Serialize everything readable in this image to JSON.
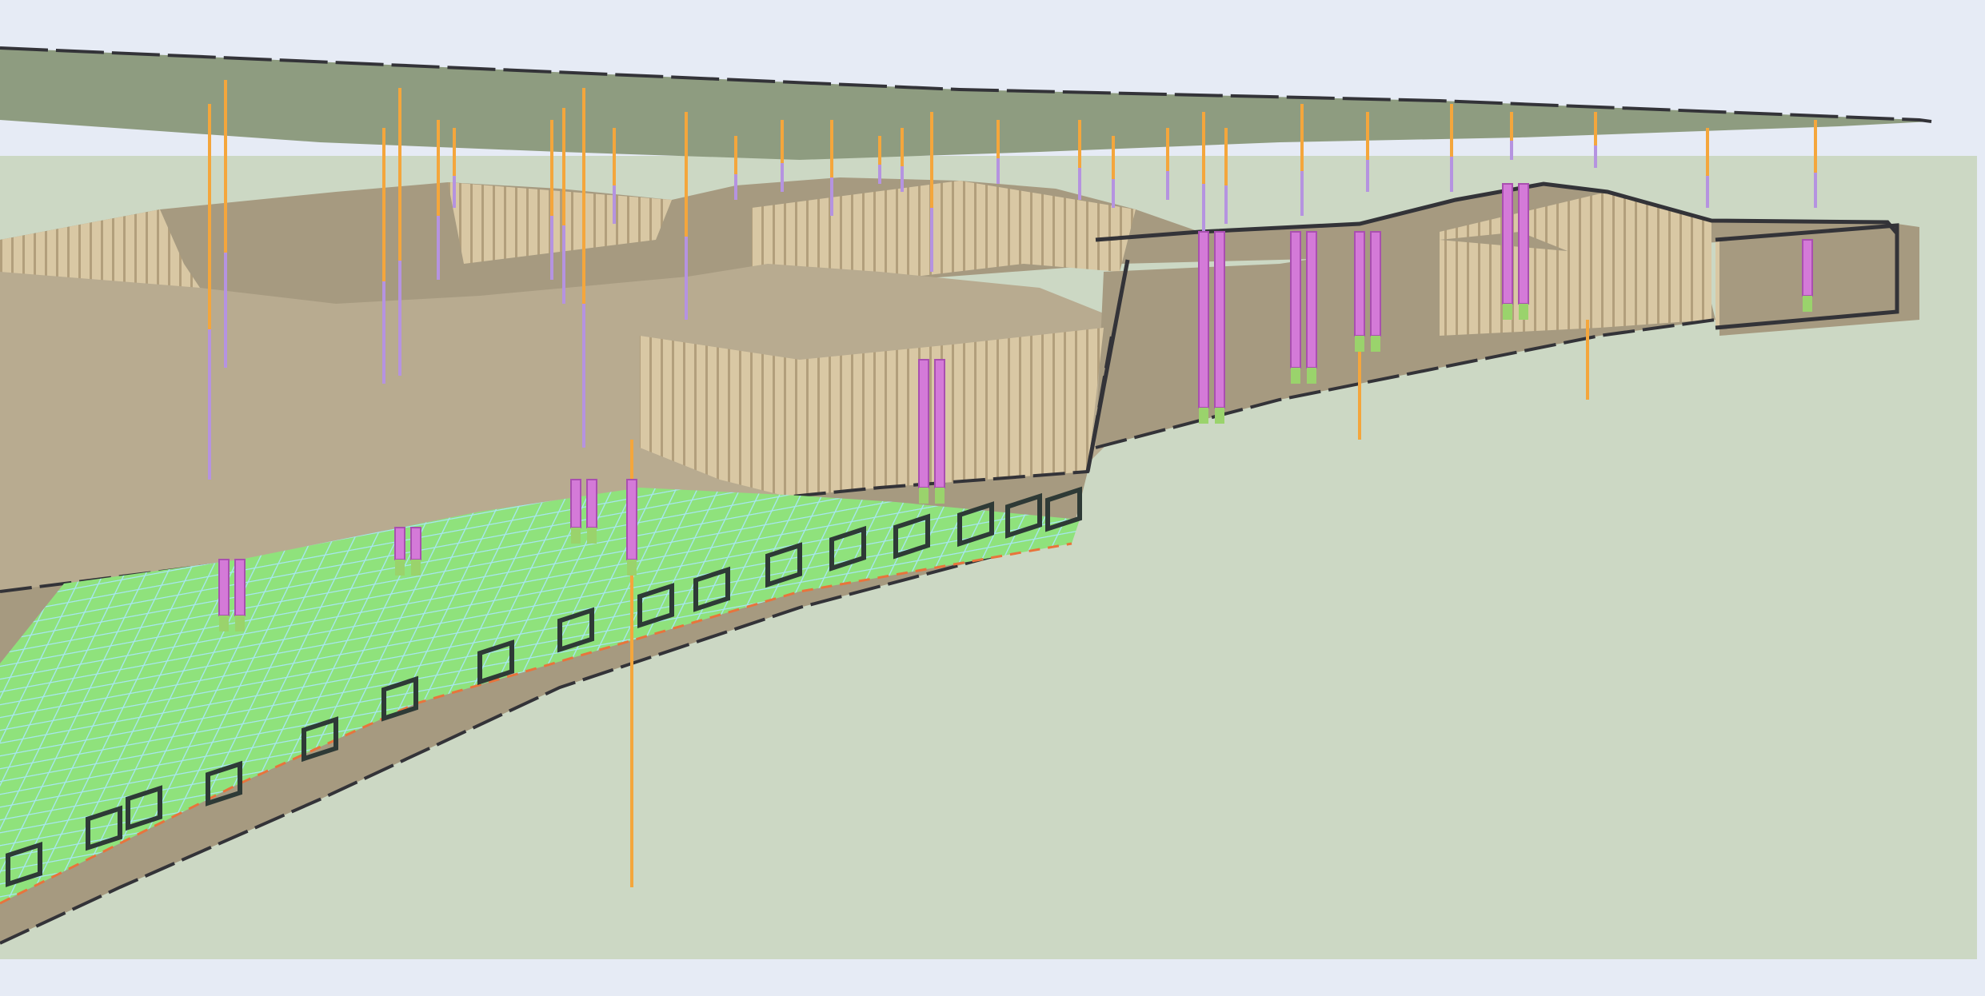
{
  "scene": {
    "colors": {
      "sky": "#e6ebf5",
      "ground_background": "#ccd8c4",
      "top_horizon_surface": "#8e9c80",
      "terrain_surface": "#a69a80",
      "terrain_surface_light": "#b8ab90",
      "cliff_face": "#d9c8a4",
      "cliff_stripe": "#b29f7c",
      "boundary_line": "#333338",
      "well_orange": "#f4a63c",
      "well_purple": "#b593e0",
      "well_magenta": "#d47ad8",
      "well_green": "#9ad36c",
      "mesh_green": "#8fe27c",
      "mesh_cyan": "#a6e6ee",
      "fault_dark": "#2e3a36",
      "basal_orange": "#e8743c"
    },
    "layers": [
      "top-horizon",
      "upper-terrain",
      "mid-terrain",
      "lower-terrain",
      "fault-mesh-surface"
    ],
    "well_colors": [
      "orange",
      "purple",
      "magenta",
      "green"
    ]
  }
}
